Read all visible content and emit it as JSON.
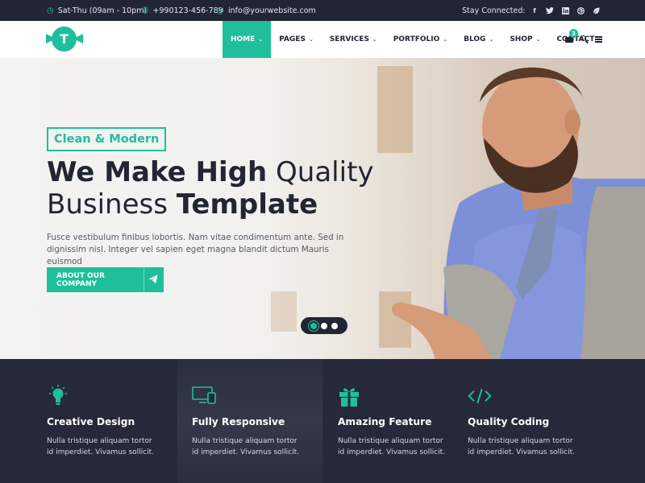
{
  "topbar": {
    "hours": "Sat-Thu (09am - 10pm)",
    "phone": "+990123-456-789",
    "email": "info@yourwebsite.com",
    "stay_connected": "Stay Connected:",
    "social_icons": [
      "facebook-icon",
      "twitter-icon",
      "linkedin-icon",
      "dribbble-icon",
      "leaf-icon"
    ]
  },
  "nav": {
    "logo_letter": "T",
    "items": [
      {
        "label": "HOME",
        "dropdown": true,
        "active": true
      },
      {
        "label": "PAGES",
        "dropdown": true
      },
      {
        "label": "SERVICES",
        "dropdown": true
      },
      {
        "label": "PORTFOLIO",
        "dropdown": true
      },
      {
        "label": "BLOG",
        "dropdown": true
      },
      {
        "label": "SHOP",
        "dropdown": true
      },
      {
        "label": "CONTACT",
        "dropdown": false
      }
    ],
    "cart_count": "3"
  },
  "hero": {
    "tag": "Clean & Modern",
    "headline_1_bold": "We Make High",
    "headline_1_light": "Quality",
    "headline_2_light": "Business",
    "headline_2_bold": "Template",
    "paragraph": "Fusce vestibulum finibus lobortis. Nam vitae condimentum ante. Sed in dignissim nisl. Integer vel sapien eget magna blandit dictum Mauris euismod",
    "button_label": "ABOUT OUR COMPANY",
    "slides": 3,
    "active_slide": 1
  },
  "features": [
    {
      "icon": "lightbulb-icon",
      "title": "Creative Design",
      "text": "Nulla tristique aliquam tortor id imperdiet. Vivamus sollicit."
    },
    {
      "icon": "devices-icon",
      "title": "Fully Responsive",
      "text": "Nulla tristique aliquam tortor id imperdiet. Vivamus sollicit."
    },
    {
      "icon": "gift-icon",
      "title": "Amazing Feature",
      "text": "Nulla tristique aliquam tortor id imperdiet. Vivamus sollicit."
    },
    {
      "icon": "code-icon",
      "title": "Quality Coding",
      "text": "Nulla tristique aliquam tortor id imperdiet. Vivamus sollicit."
    }
  ],
  "colors": {
    "accent": "#1fbf9b",
    "dark": "#222533",
    "feature_bg": "#262939"
  }
}
